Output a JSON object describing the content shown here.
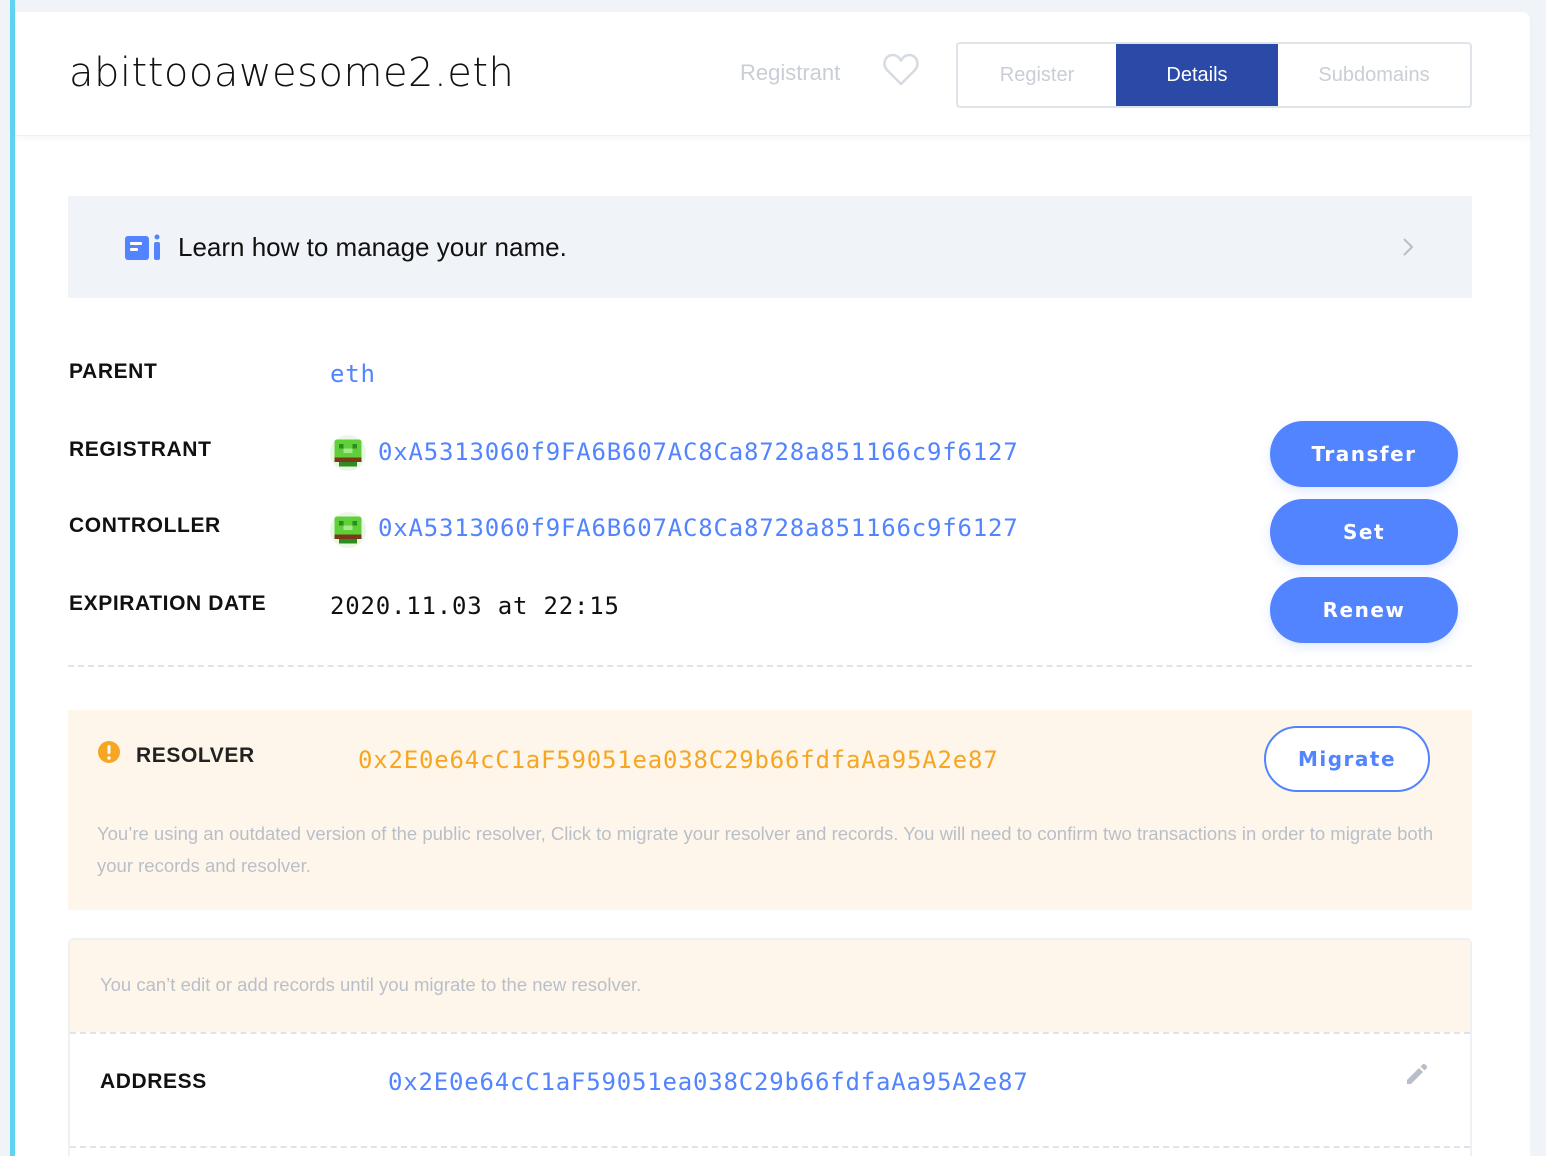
{
  "header": {
    "domain_name": "abittooawesome2.eth",
    "registrant_link": "Registrant",
    "tabs": [
      {
        "label": "Register",
        "active": false
      },
      {
        "label": "Details",
        "active": true
      },
      {
        "label": "Subdomains",
        "active": false
      }
    ]
  },
  "banner": {
    "text": "Learn how to manage your name.",
    "icon": "book-icon"
  },
  "details": {
    "parent": {
      "label": "PARENT",
      "value": "eth"
    },
    "registrant": {
      "label": "REGISTRANT",
      "value": "0xA5313060f9FA6B607AC8Ca8728a851166c9f6127",
      "button": "Transfer"
    },
    "controller": {
      "label": "CONTROLLER",
      "value": "0xA5313060f9FA6B607AC8Ca8728a851166c9f6127",
      "button": "Set"
    },
    "expiration": {
      "label": "EXPIRATION DATE",
      "value": "2020.11.03 at 22:15",
      "button": "Renew"
    }
  },
  "resolver": {
    "label": "RESOLVER",
    "value": "0x2E0e64cC1aF59051ea038C29b66fdfaAa95A2e87",
    "button": "Migrate",
    "note": "You’re using an outdated version of the public resolver, Click to migrate your resolver and records. You will need to confirm two transactions in order to migrate both your records and resolver."
  },
  "records": {
    "note": "You can’t edit or add records until you migrate to the new resolver.",
    "address": {
      "label": "ADDRESS",
      "value": "0x2E0e64cC1aF59051ea038C29b66fdfaAa95A2e87"
    }
  },
  "colors": {
    "accent": "#5284ff",
    "tab_active": "#2b4aa8",
    "warning": "#f6a623",
    "warning_bg": "#fef6ea",
    "rail": "#5fd3f0"
  }
}
